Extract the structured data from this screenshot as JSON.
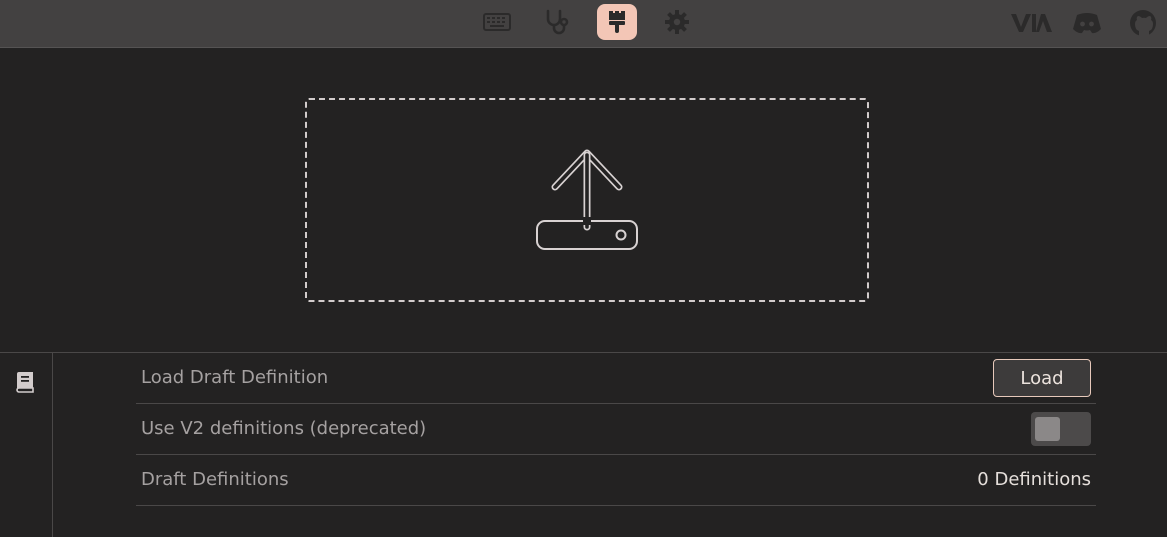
{
  "topbar": {
    "nav": [
      {
        "icon": "keyboard-icon",
        "active": false
      },
      {
        "icon": "stethoscope-icon",
        "active": false
      },
      {
        "icon": "paintbrush-icon",
        "active": true
      },
      {
        "icon": "gear-icon",
        "active": false
      }
    ],
    "right_icons": [
      "via-logo-icon",
      "discord-icon",
      "github-icon"
    ],
    "accent_color": "#f3c6b6"
  },
  "upload": {
    "icon": "upload-tray-icon"
  },
  "sidebar": {
    "icon": "book-icon"
  },
  "settings": {
    "load_draft": {
      "label": "Load Draft Definition",
      "button_label": "Load"
    },
    "use_v2": {
      "label": "Use V2 definitions (deprecated)",
      "enabled": false
    },
    "draft_definitions": {
      "label": "Draft Definitions",
      "value": "0 Definitions"
    }
  }
}
